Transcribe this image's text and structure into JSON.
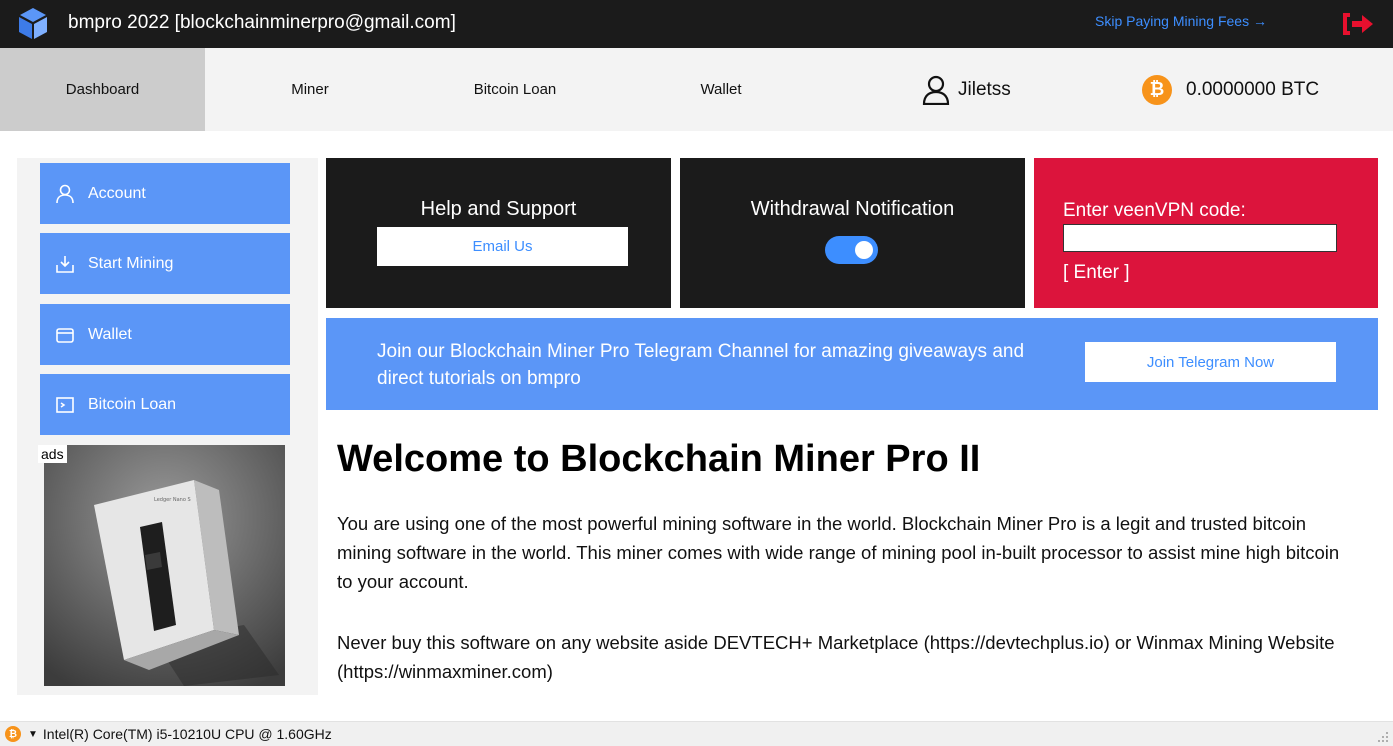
{
  "titlebar": {
    "title": "bmpro 2022 [blockchainminerpro@gmail.com]",
    "skip_link": "Skip Paying Mining Fees →",
    "logo_icon": "blockchain-cube-logo",
    "exit_icon": "exit-arrow-icon"
  },
  "nav": {
    "tabs": [
      {
        "label": "Dashboard",
        "active": true
      },
      {
        "label": "Miner",
        "active": false
      },
      {
        "label": "Bitcoin Loan",
        "active": false
      },
      {
        "label": "Wallet",
        "active": false
      }
    ],
    "username": "Jiletss",
    "balance": "0.0000000 BTC",
    "coin_symbol": "₿"
  },
  "sidebar": {
    "items": [
      {
        "label": "Account",
        "icon": "user-icon"
      },
      {
        "label": "Start Mining",
        "icon": "download-tray-icon"
      },
      {
        "label": "Wallet",
        "icon": "wallet-icon"
      },
      {
        "label": "Bitcoin Loan",
        "icon": "terminal-icon"
      }
    ],
    "ads_label": "ads",
    "ad_product_text": "Ledger Nano S"
  },
  "cards": {
    "support": {
      "title": "Help and Support",
      "button": "Email Us"
    },
    "withdrawal": {
      "title": "Withdrawal Notification",
      "toggle_on": true
    },
    "vpn": {
      "label": "Enter veenVPN code:",
      "input_value": "",
      "enter": "[ Enter ]"
    }
  },
  "telegram": {
    "text": "Join our Blockchain Miner Pro Telegram Channel for amazing giveaways and direct tutorials on bmpro",
    "button": "Join Telegram Now"
  },
  "welcome": {
    "title": "Welcome to Blockchain Miner Pro II",
    "paragraph1": "You are using one of the most powerful mining software in the world. Blockchain Miner Pro is a legit and trusted bitcoin mining software in the world. This miner comes with wide range of mining pool in-built processor to assist mine high bitcoin to your account.",
    "paragraph2": "Never buy this software on any website aside DEVTECH+ Marketplace (https://devtechplus.io) or Winmax Mining Website (https://winmaxminer.com)"
  },
  "statusbar": {
    "cpu": "Intel(R) Core(TM) i5-10210U CPU @ 1.60GHz",
    "caret": "▼"
  },
  "colors": {
    "titlebar_bg": "#1b1b1b",
    "accent_blue": "#5b96f7",
    "link_blue": "#3d8eff",
    "vpn_red": "#dc143c",
    "btc_orange": "#f7931a"
  }
}
